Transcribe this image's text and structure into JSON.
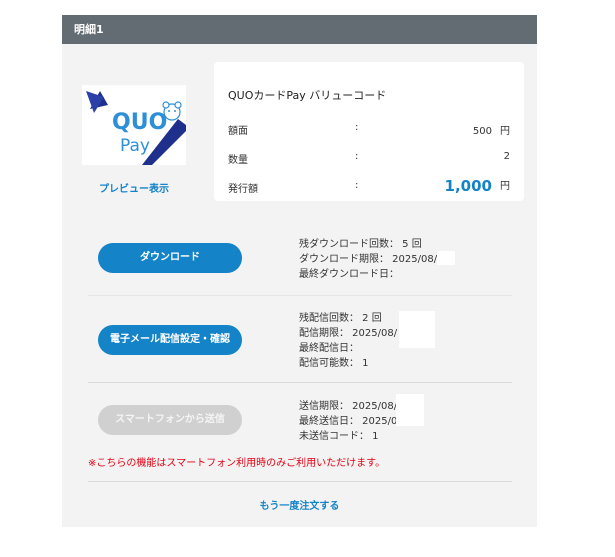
{
  "header": {
    "title": "明細1"
  },
  "product": {
    "logo_text_top": "QUO",
    "logo_text_bottom": "Pay",
    "preview_link": "プレビュー表示",
    "title": "QUOカードPay バリューコード",
    "rows": [
      {
        "label": "額面",
        "colon": ":",
        "value": "500",
        "unit": "円"
      },
      {
        "label": "数量",
        "colon": ":",
        "value": "2",
        "unit": ""
      },
      {
        "label": "発行額",
        "colon": ":",
        "value": "1,000",
        "unit": "円"
      }
    ]
  },
  "download": {
    "button_label": "ダウンロード",
    "lines": [
      "残ダウンロード回数： 5 回",
      "ダウンロード期限： 2025/08/",
      "最終ダウンロード日："
    ]
  },
  "email": {
    "button_label": "電子メール配信設定・確認",
    "lines": [
      "残配信回数： 2 回",
      "配信期限： 2025/08/",
      "最終配信日：",
      "配信可能数： 1"
    ]
  },
  "smartphone": {
    "button_label": "スマートフォンから送信",
    "lines": [
      "送信期限： 2025/08/",
      "最終送信日： 2025/07/",
      "未送信コード： 1"
    ]
  },
  "note": "※こちらの機能はスマートフォン利用時のみご利用いただけます。",
  "reorder_link": "もう一度注文する",
  "colors": {
    "accent": "#1583c8",
    "header_bg": "#646c73",
    "panel_bg": "#f3f3f3",
    "note": "#e60012",
    "disabled": "#d0d0d0"
  }
}
